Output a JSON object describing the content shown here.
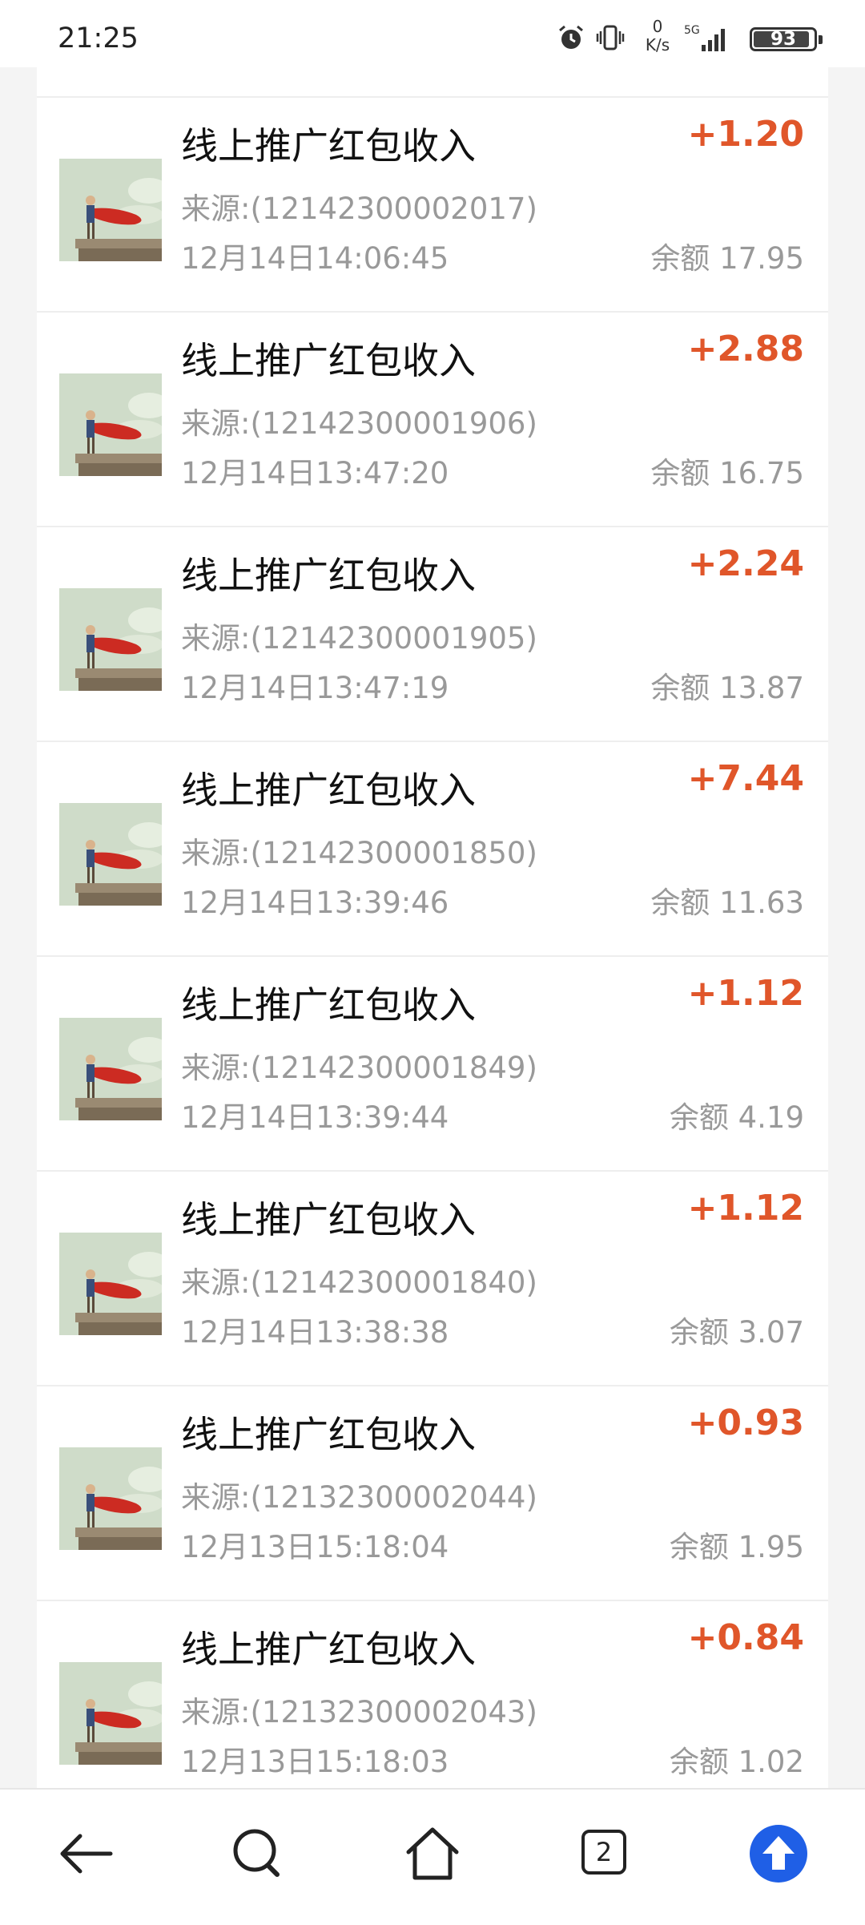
{
  "status_bar": {
    "time": "21:25",
    "net_speed_value": "0",
    "net_speed_unit": "K/s",
    "network": "5G",
    "battery": "93",
    "icons": [
      "alarm-icon",
      "vibrate-icon",
      "signal-icon",
      "battery-icon"
    ]
  },
  "transactions": [
    {
      "title": "线上推广红包收入",
      "amount": "+1.20",
      "source": "来源:(12142300002017)",
      "datetime": "12月14日14:06:45",
      "balance": "余额 17.95"
    },
    {
      "title": "线上推广红包收入",
      "amount": "+2.88",
      "source": "来源:(12142300001906)",
      "datetime": "12月14日13:47:20",
      "balance": "余额 16.75"
    },
    {
      "title": "线上推广红包收入",
      "amount": "+2.24",
      "source": "来源:(12142300001905)",
      "datetime": "12月14日13:47:19",
      "balance": "余额 13.87"
    },
    {
      "title": "线上推广红包收入",
      "amount": "+7.44",
      "source": "来源:(12142300001850)",
      "datetime": "12月14日13:39:46",
      "balance": "余额 11.63"
    },
    {
      "title": "线上推广红包收入",
      "amount": "+1.12",
      "source": "来源:(12142300001849)",
      "datetime": "12月14日13:39:44",
      "balance": "余额 4.19"
    },
    {
      "title": "线上推广红包收入",
      "amount": "+1.12",
      "source": "来源:(12142300001840)",
      "datetime": "12月14日13:38:38",
      "balance": "余额 3.07"
    },
    {
      "title": "线上推广红包收入",
      "amount": "+0.93",
      "source": "来源:(12132300002044)",
      "datetime": "12月13日15:18:04",
      "balance": "余额 1.95"
    },
    {
      "title": "线上推广红包收入",
      "amount": "+0.84",
      "source": "来源:(12132300002043)",
      "datetime": "12月13日15:18:03",
      "balance": "余额 1.02"
    }
  ],
  "bottom_nav": {
    "tab_count": "2",
    "items": [
      "back-icon",
      "search-icon",
      "home-icon",
      "tabs-icon",
      "scroll-up-icon"
    ]
  },
  "colors": {
    "amount": "#e0562a",
    "accent_blue": "#1f5fe6",
    "muted_text": "#999999"
  }
}
